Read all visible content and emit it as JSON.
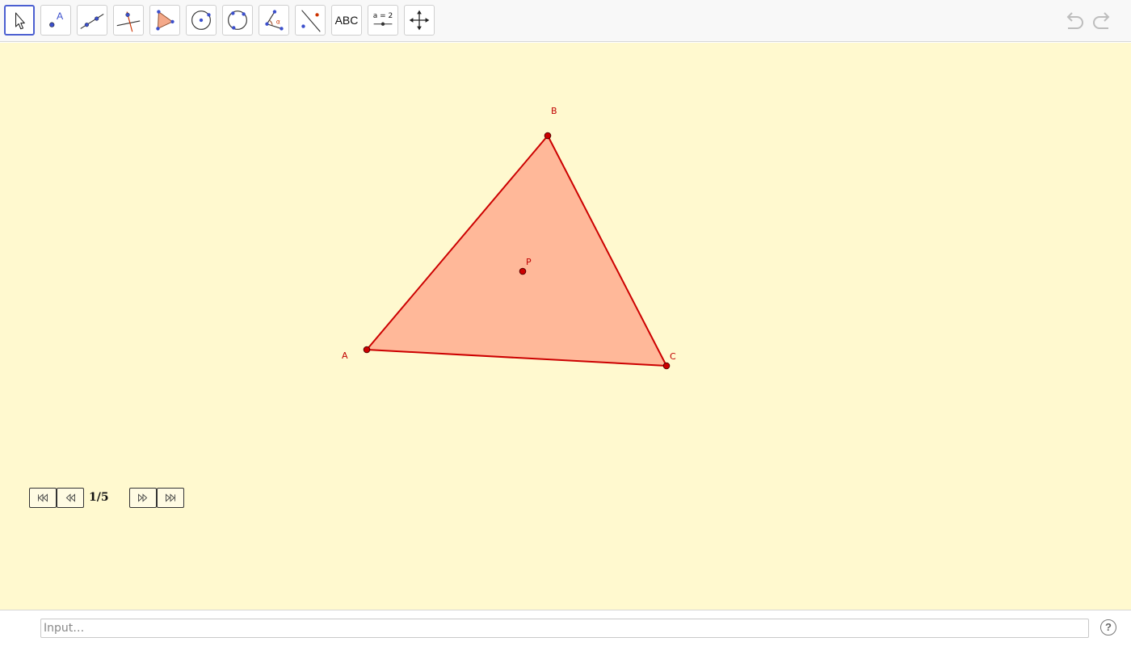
{
  "toolbar": {
    "tools": [
      {
        "name": "move-tool",
        "icon": "arrow-cursor-icon",
        "active": true
      },
      {
        "name": "point-tool",
        "icon": "point-icon",
        "label": "A"
      },
      {
        "name": "line-tool",
        "icon": "line-through-two-points-icon"
      },
      {
        "name": "perpendicular-line-tool",
        "icon": "perpendicular-line-icon"
      },
      {
        "name": "polygon-tool",
        "icon": "polygon-icon"
      },
      {
        "name": "circle-center-point-tool",
        "icon": "circle-center-point-icon"
      },
      {
        "name": "circle-three-points-tool",
        "icon": "circle-three-points-icon"
      },
      {
        "name": "angle-tool",
        "icon": "angle-icon",
        "label": "α"
      },
      {
        "name": "reflect-about-line-tool",
        "icon": "reflect-icon"
      },
      {
        "name": "text-tool",
        "icon": "text-icon",
        "label": "ABC"
      },
      {
        "name": "slider-tool",
        "icon": "slider-icon",
        "label": "a = 2"
      },
      {
        "name": "move-graphics-view-tool",
        "icon": "move-graphics-view-icon"
      }
    ],
    "undo_icon": "undo-icon",
    "redo_icon": "redo-icon"
  },
  "graphics": {
    "background": "#fff9cf",
    "points": [
      {
        "label": "A"
      },
      {
        "label": "B"
      },
      {
        "label": "C"
      },
      {
        "label": "P"
      }
    ],
    "polygon": {
      "fill": "#ffb899",
      "stroke": "#cc0000"
    }
  },
  "navigation": {
    "current_step": "1/5",
    "buttons": [
      "first-step-icon",
      "previous-step-icon",
      "next-step-icon",
      "last-step-icon"
    ]
  },
  "input_bar": {
    "placeholder": "Input…",
    "help_label": "?"
  }
}
